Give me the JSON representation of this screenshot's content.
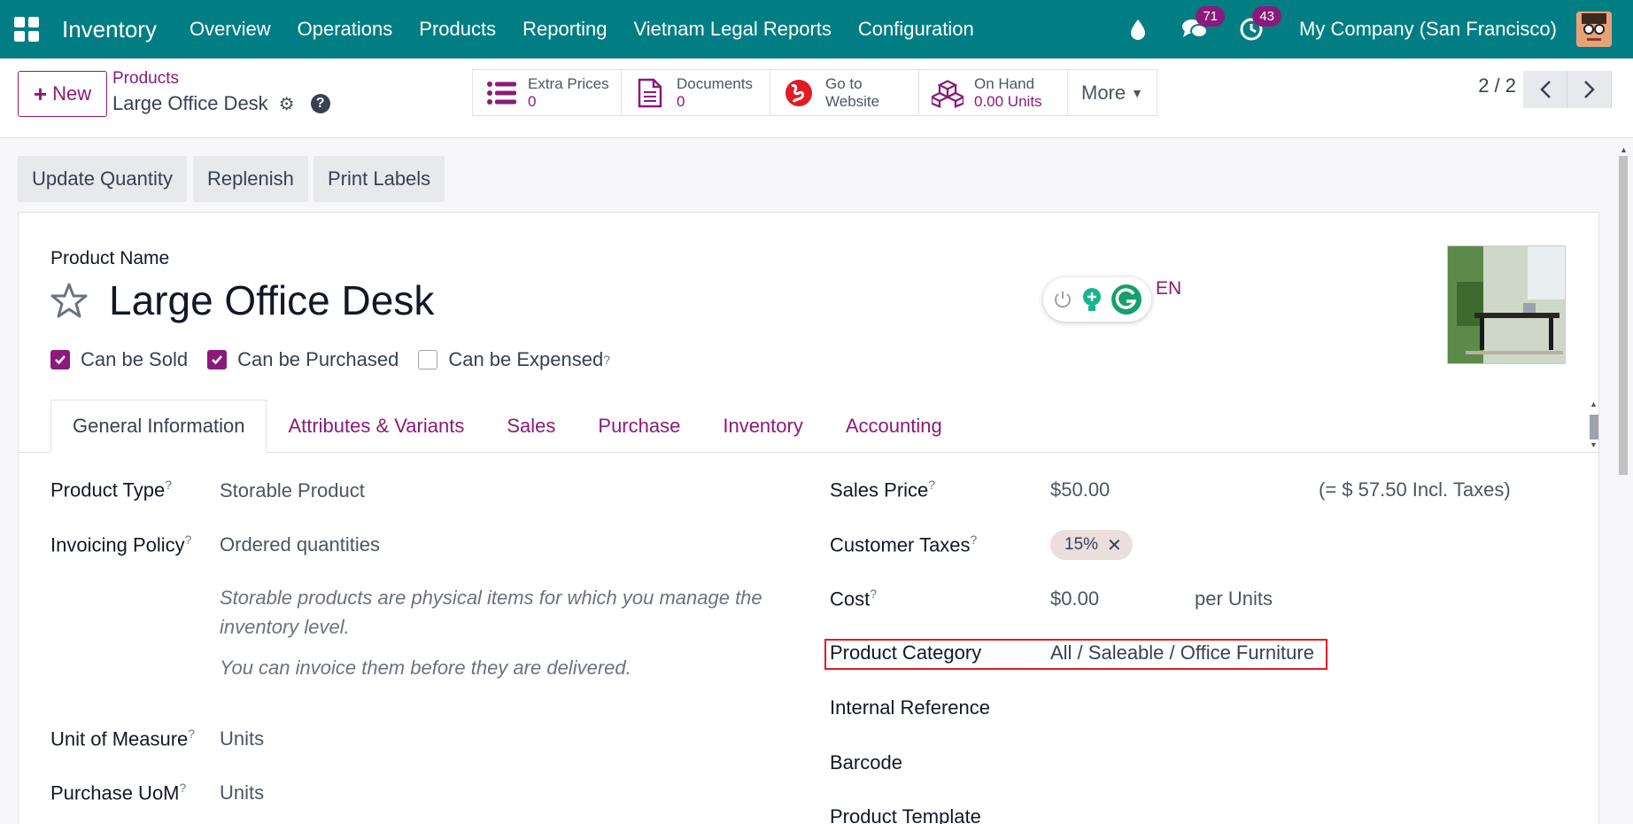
{
  "navbar": {
    "app_name": "Inventory",
    "menu": [
      "Overview",
      "Operations",
      "Products",
      "Reporting",
      "Vietnam Legal Reports",
      "Configuration"
    ],
    "messages_count": "71",
    "activities_count": "43",
    "company": "My Company (San Francisco)"
  },
  "control": {
    "new_label": "New",
    "breadcrumb": "Products",
    "record_name": "Large Office Desk",
    "smart": {
      "extra_prices_label": "Extra Prices",
      "extra_prices_value": "0",
      "documents_label": "Documents",
      "documents_value": "0",
      "website_line1": "Go to",
      "website_line2": "Website",
      "onhand_label": "On Hand",
      "onhand_value": "0.00 Units",
      "more_label": "More"
    },
    "pager": "2 / 2"
  },
  "actions": [
    "Update Quantity",
    "Replenish",
    "Print Labels"
  ],
  "form": {
    "product_name_label": "Product Name",
    "product_name": "Large Office Desk",
    "lang": "EN",
    "can_be_sold": "Can be Sold",
    "can_be_purchased": "Can be Purchased",
    "can_be_expensed": "Can be Expensed",
    "tabs": [
      "General Information",
      "Attributes & Variants",
      "Sales",
      "Purchase",
      "Inventory",
      "Accounting"
    ],
    "left": {
      "product_type_label": "Product Type",
      "product_type": "Storable Product",
      "invoicing_label": "Invoicing Policy",
      "invoicing": "Ordered quantities",
      "note1": "Storable products are physical items for which you manage the inventory level.",
      "note2": "You can invoice them before they are delivered.",
      "uom_label": "Unit of Measure",
      "uom": "Units",
      "purchase_uom_label": "Purchase UoM",
      "purchase_uom": "Units"
    },
    "right": {
      "sales_price_label": "Sales Price",
      "sales_price": "$50.00",
      "incl_taxes": "(= $ 57.50 Incl. Taxes)",
      "customer_taxes_label": "Customer Taxes",
      "tax_tag": "15%",
      "cost_label": "Cost",
      "cost": "$0.00",
      "per_units": "per Units",
      "category_label": "Product Category",
      "category": "All / Saleable / Office Furniture",
      "internal_ref_label": "Internal Reference",
      "barcode_label": "Barcode",
      "template_label": "Product Template"
    }
  },
  "colors": {
    "navbar": "#017e84",
    "accent": "#8b1a7a",
    "highlight": "#e31b23"
  }
}
